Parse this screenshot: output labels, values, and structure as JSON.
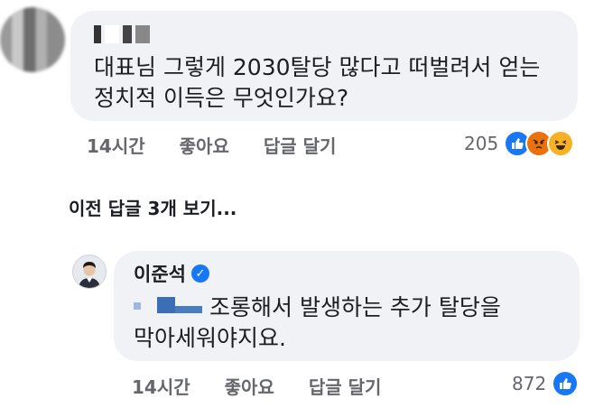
{
  "comment": {
    "text": "대표님 그렇게 2030탈당 많다고 떠벌려서 얻는\n정치적 이득은 무엇인가요?",
    "time": "14시간",
    "like_label": "좋아요",
    "reply_label": "답글 달기",
    "reaction_count": "205",
    "reactions": [
      "like-icon",
      "angry-icon",
      "haha-icon"
    ]
  },
  "view_previous": "이전 답글 3개 보기...",
  "reply": {
    "author": "이준석",
    "text_line1": "조롱해서 발생하는 추가 탈당을",
    "text_line2": "막아세워야지요.",
    "time": "14시간",
    "like_label": "좋아요",
    "reply_label": "답글 달기",
    "reaction_count": "872",
    "reactions": [
      "like-icon"
    ]
  },
  "colors": {
    "bubble": "#f0f2f5",
    "secondary_text": "#65676b",
    "like_blue": "#1877f2",
    "censor_blue": "#3b6fb5"
  }
}
